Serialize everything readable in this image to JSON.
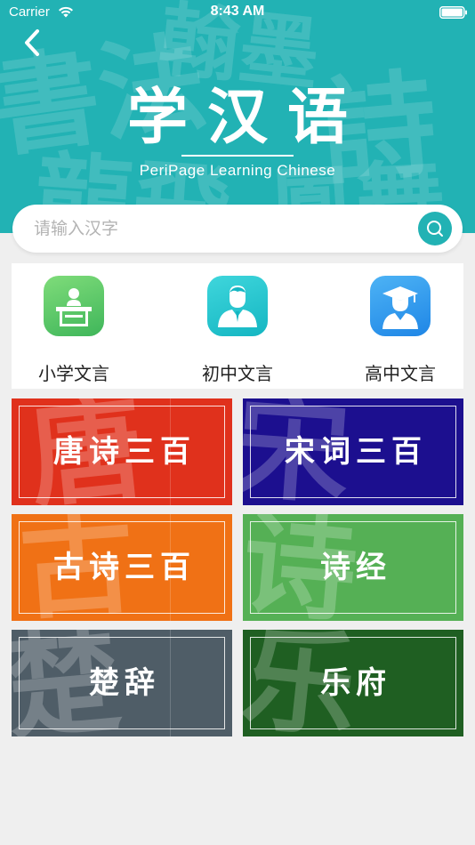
{
  "status_bar": {
    "carrier": "Carrier",
    "time": "8:43 AM"
  },
  "header": {
    "title": "学汉语",
    "subtitle": "PeriPage Learning Chinese",
    "background_color": "#22b2b4"
  },
  "search": {
    "placeholder": "请输入汉字",
    "value": "",
    "icon": "search-icon"
  },
  "levels": [
    {
      "label": "小学文言",
      "icon": "pupil-desk-icon",
      "color": "#5cc96a"
    },
    {
      "label": "初中文言",
      "icon": "student-icon",
      "color": "#21c3cc"
    },
    {
      "label": "高中文言",
      "icon": "graduate-cap-icon",
      "color": "#2d9bf0"
    }
  ],
  "cards": [
    {
      "title": "唐诗三百",
      "watermark": "唐",
      "color": "#e0311c"
    },
    {
      "title": "宋词三百",
      "watermark": "宋",
      "color": "#1c0f8f"
    },
    {
      "title": "古诗三百",
      "watermark": "古",
      "color": "#f07115"
    },
    {
      "title": "诗经",
      "watermark": "诗",
      "color": "#55b055"
    },
    {
      "title": "楚辞",
      "watermark": "楚",
      "color": "#4f5d67"
    },
    {
      "title": "乐府",
      "watermark": "乐",
      "color": "#1f5f22"
    }
  ]
}
